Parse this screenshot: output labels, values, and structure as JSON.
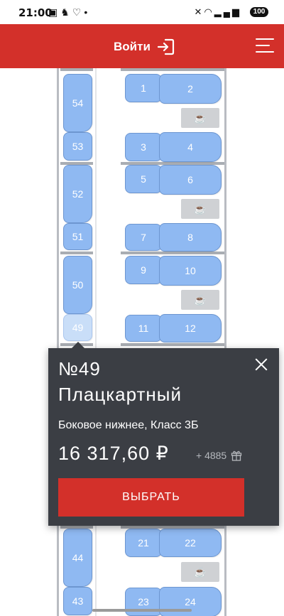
{
  "status_bar": {
    "time": "21:00",
    "battery": "100"
  },
  "header": {
    "login_label": "Войти"
  },
  "side_seats": [
    "54",
    "53",
    "52",
    "51",
    "50",
    "49",
    "44",
    "43"
  ],
  "compartment_seats": [
    "1",
    "2",
    "3",
    "4",
    "5",
    "6",
    "7",
    "8",
    "9",
    "10",
    "11",
    "12",
    "21",
    "22",
    "23",
    "24"
  ],
  "popup": {
    "seat_number": "№49",
    "car_type": "Плацкартный",
    "seat_description": "Боковое нижнее, Класс 3Б",
    "price": "16 317,60 ₽",
    "bonus": "+ 4885",
    "select_label": "ВЫБРАТЬ"
  },
  "selected_seat": "49",
  "icons": [
    "gallery-icon",
    "notification-icon",
    "heart-icon",
    "mute-icon",
    "wifi-icon",
    "signal-icon",
    "login-icon",
    "menu-icon",
    "coffee-icon",
    "gift-icon",
    "close-icon"
  ],
  "colors": {
    "brand_red": "#d3302a",
    "seat_blue": "#8fb9f2",
    "selected_seat": "#c9def8",
    "popup_bg": "#3b3e44"
  }
}
